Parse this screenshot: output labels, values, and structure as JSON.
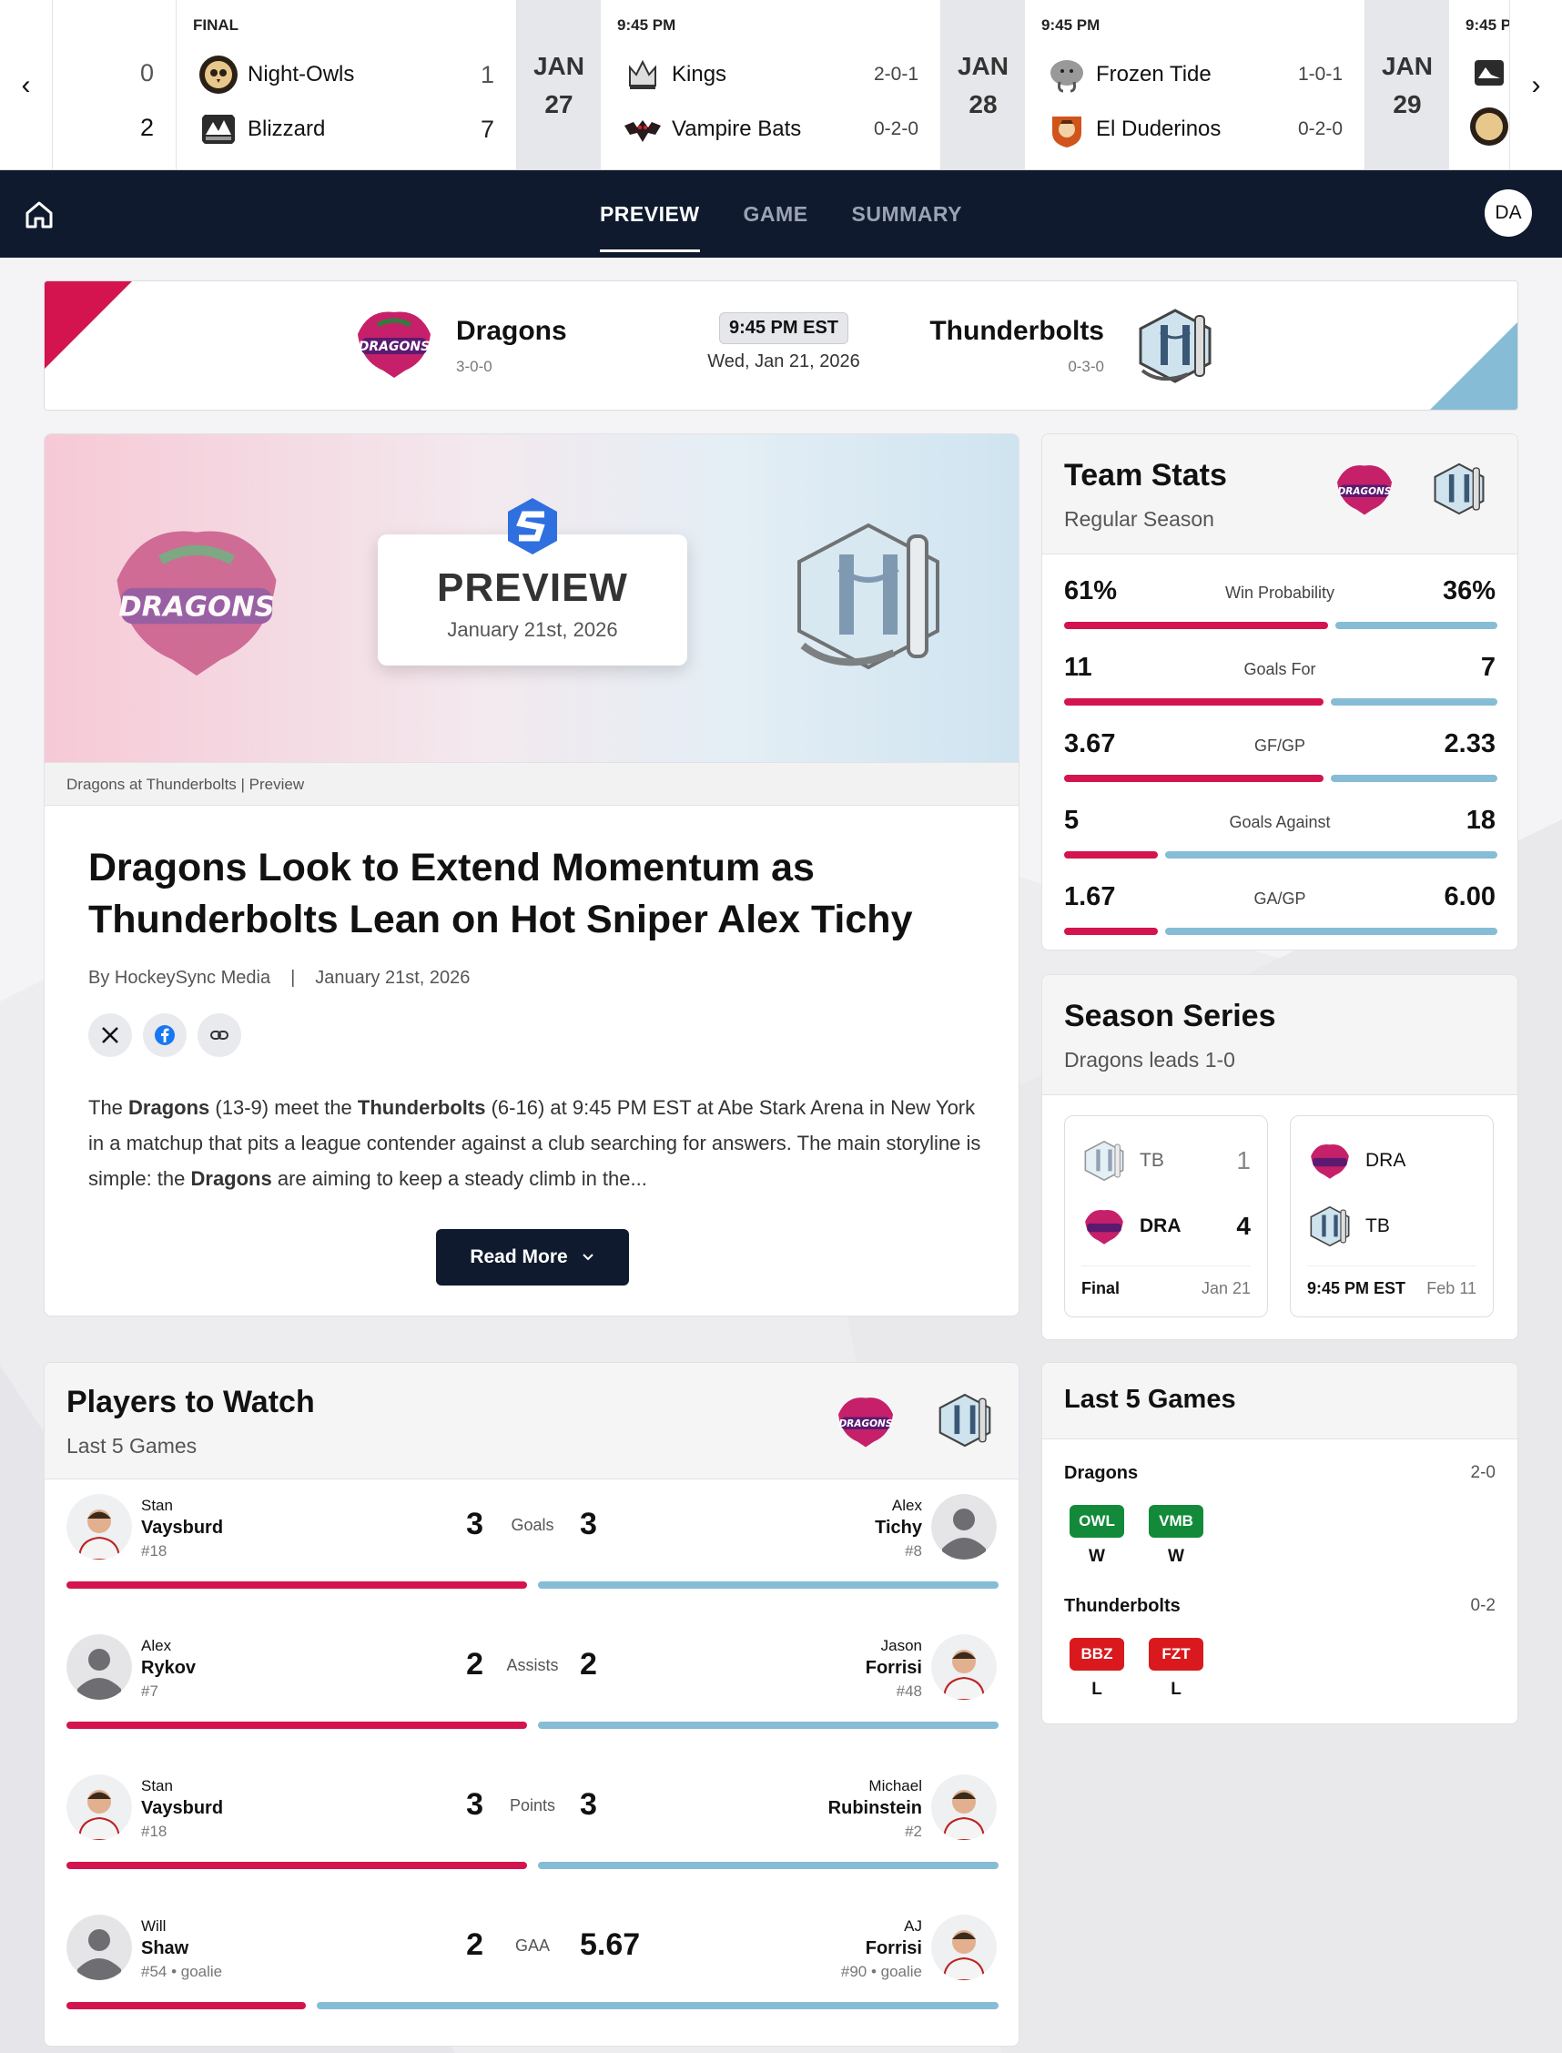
{
  "strip": {
    "game0": {
      "away_score": "0",
      "home_score": "2"
    },
    "game1": {
      "status": "FINAL",
      "team1": "Night-Owls",
      "score1": "1",
      "team2": "Blizzard",
      "score2": "7"
    },
    "date1": {
      "month": "JAN",
      "day": "27"
    },
    "game2": {
      "status": "9:45 PM",
      "team1": "Kings",
      "rec1": "2-0-1",
      "team2": "Vampire Bats",
      "rec2": "0-2-0"
    },
    "date2": {
      "month": "JAN",
      "day": "28"
    },
    "game3": {
      "status": "9:45 PM",
      "team1": "Frozen Tide",
      "rec1": "1-0-1",
      "team2": "El Duderinos",
      "rec2": "0-2-0"
    },
    "date3": {
      "month": "JAN",
      "day": "29"
    },
    "game4": {
      "status": "9:45 P"
    }
  },
  "nav": {
    "tabs": [
      "PREVIEW",
      "GAME",
      "SUMMARY"
    ],
    "active_tab": "PREVIEW",
    "user_initials": "DA"
  },
  "matchup": {
    "away": {
      "name": "Dragons",
      "record": "3-0-0"
    },
    "home": {
      "name": "Thunderbolts",
      "record": "0-3-0"
    },
    "time": "9:45 PM EST",
    "date": "Wed, Jan 21, 2026"
  },
  "article": {
    "hero_title": "PREVIEW",
    "hero_date": "January 21st, 2026",
    "caption": "Dragons at Thunderbolts | Preview",
    "headline": "Dragons Look to Extend Momentum as Thunderbolts Lean on Hot Sniper Alex Tichy",
    "byline": "By HockeySync Media",
    "byline_sep": "|",
    "byline_date": "January 21st, 2026",
    "p_1": "The ",
    "p_team1": "Dragons",
    "p_2": " (13-9) meet the ",
    "p_team2": "Thunderbolts",
    "p_3": " (6-16) at 9:45 PM EST at Abe Stark Arena in New York in a matchup that pits a league contender against a club searching for answers. The main storyline is simple: the ",
    "p_team3": "Dragons",
    "p_4": " are aiming to keep a steady climb in the...",
    "read_more": "Read More"
  },
  "team_stats": {
    "title": "Team Stats",
    "subtitle": "Regular Season",
    "rows": [
      {
        "label": "Win Probability",
        "left": "61%",
        "right": "36%",
        "left_share": 0.62
      },
      {
        "label": "Goals For",
        "left": "11",
        "right": "7",
        "left_share": 0.61
      },
      {
        "label": "GF/GP",
        "left": "3.67",
        "right": "2.33",
        "left_share": 0.61
      },
      {
        "label": "Goals Against",
        "left": "5",
        "right": "18",
        "left_share": 0.22
      },
      {
        "label": "GA/GP",
        "left": "1.67",
        "right": "6.00",
        "left_share": 0.22
      }
    ]
  },
  "season_series": {
    "title": "Season Series",
    "subtitle": "Dragons leads 1-0",
    "game1": {
      "team1": "TB",
      "score1": "1",
      "team2": "DRA",
      "score2": "4",
      "status": "Final",
      "date": "Jan 21"
    },
    "game2": {
      "team1": "DRA",
      "team2": "TB",
      "status": "9:45 PM EST",
      "date": "Feb 11"
    }
  },
  "players": {
    "title": "Players to Watch",
    "subtitle": "Last 5 Games",
    "rows": [
      {
        "label": "Goals",
        "l_first": "Stan",
        "l_last": "Vaysburd",
        "l_num": "#18",
        "l_val": "3",
        "r_first": "Alex",
        "r_last": "Tichy",
        "r_num": "#8",
        "r_val": "3",
        "left_share": 0.5
      },
      {
        "label": "Assists",
        "l_first": "Alex",
        "l_last": "Rykov",
        "l_num": "#7",
        "l_val": "2",
        "r_first": "Jason",
        "r_last": "Forrisi",
        "r_num": "#48",
        "r_val": "2",
        "left_share": 0.5
      },
      {
        "label": "Points",
        "l_first": "Stan",
        "l_last": "Vaysburd",
        "l_num": "#18",
        "l_val": "3",
        "r_first": "Michael",
        "r_last": "Rubinstein",
        "r_num": "#2",
        "r_val": "3",
        "left_share": 0.5
      },
      {
        "label": "GAA",
        "l_first": "Will",
        "l_last": "Shaw",
        "l_num": "#54 • goalie",
        "l_val": "2",
        "r_first": "AJ",
        "r_last": "Forrisi",
        "r_num": "#90 • goalie",
        "r_val": "5.67",
        "left_share": 0.26
      }
    ]
  },
  "last5": {
    "title": "Last 5 Games",
    "team1": {
      "name": "Dragons",
      "record": "2-0",
      "games": [
        {
          "abbr": "OWL",
          "result": "W"
        },
        {
          "abbr": "VMB",
          "result": "W"
        }
      ]
    },
    "team2": {
      "name": "Thunderbolts",
      "record": "0-2",
      "games": [
        {
          "abbr": "BBZ",
          "result": "L"
        },
        {
          "abbr": "FZT",
          "result": "L"
        }
      ]
    }
  },
  "colors": {
    "dragons": "#d4144f",
    "thunderbolts": "#86bcd6",
    "nav_bg": "#0f1a2e",
    "win": "#138a3a",
    "loss": "#d9191e"
  }
}
